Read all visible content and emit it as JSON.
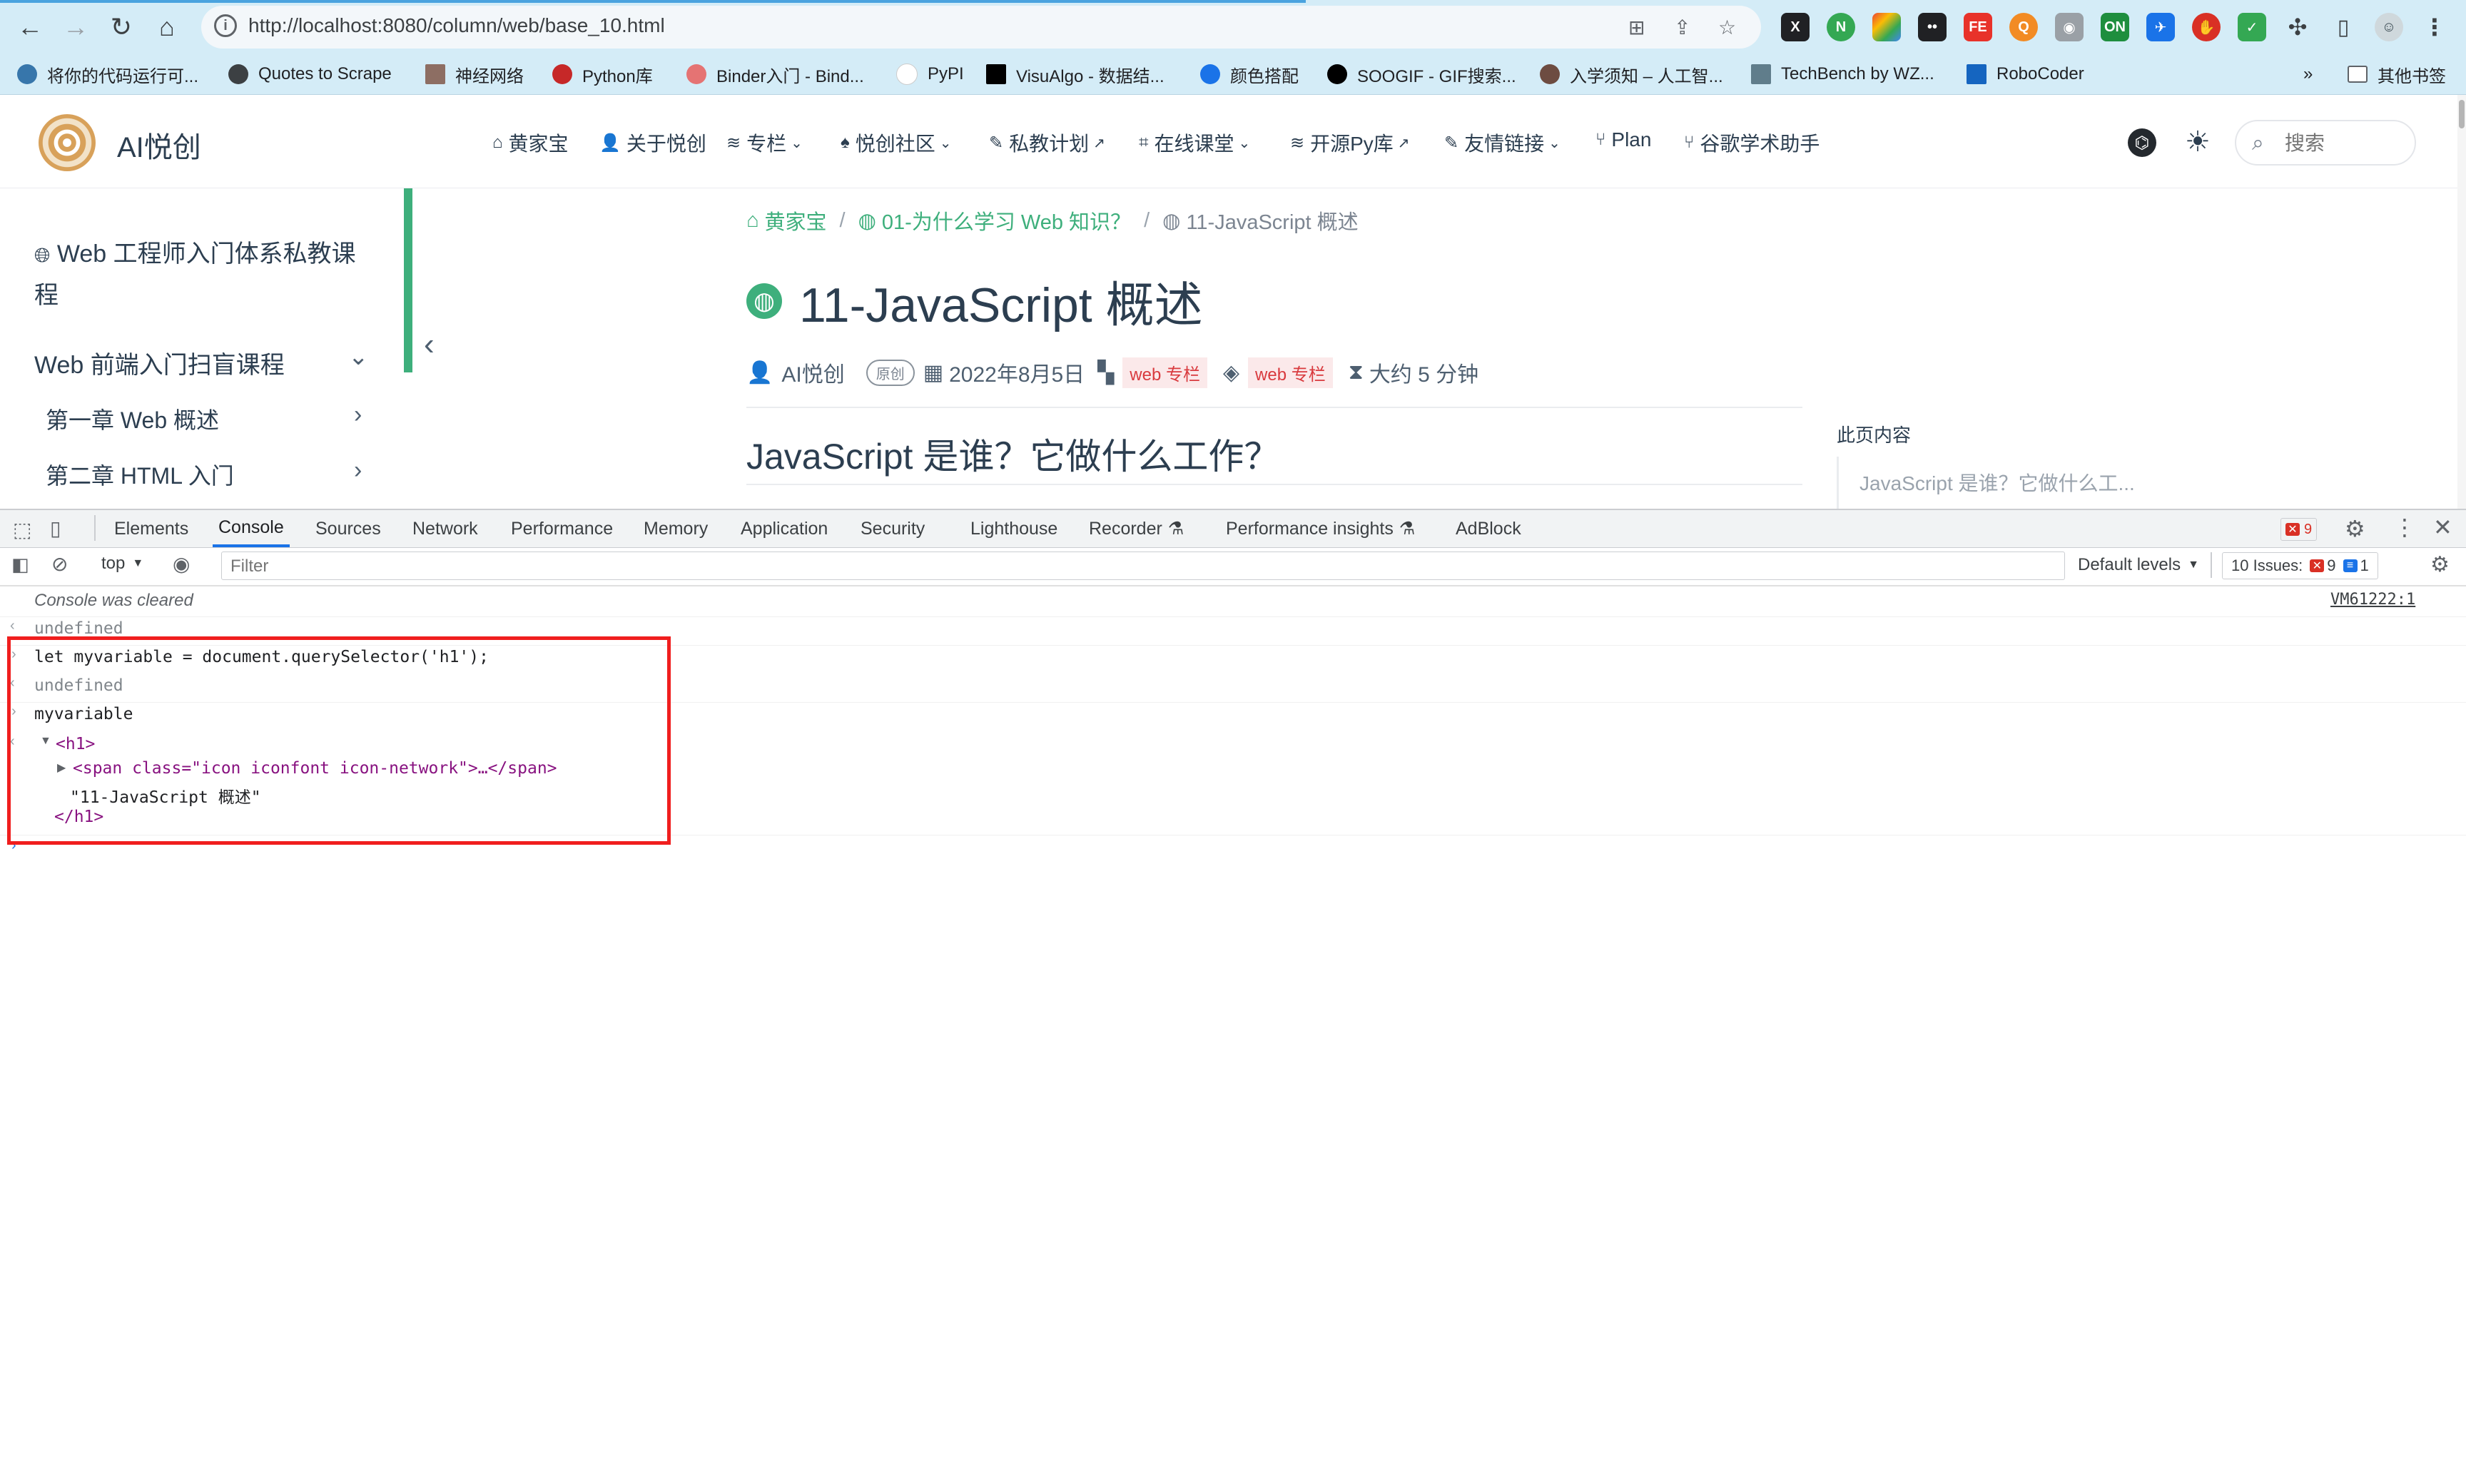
{
  "browser": {
    "url": "http://localhost:8080/column/web/base_10.html",
    "bookmarks": [
      "将你的代码运行可...",
      "Quotes to Scrape",
      "神经网络",
      "Python库",
      "Binder入门 - Bind...",
      "PyPI",
      "VisuAlgo - 数据结...",
      "颜色搭配",
      "SOOGIF - GIF搜索...",
      "入学须知 – 人工智...",
      "TechBench by WZ...",
      "RoboCoder"
    ],
    "bookmarks_more": "»",
    "other_bookmarks": "其他书签"
  },
  "site": {
    "title": "AI悦创",
    "nav": [
      "黄家宝",
      "关于悦创",
      "专栏",
      "悦创社区",
      "私教计划",
      "在线课堂",
      "开源Py库",
      "友情链接",
      "Plan",
      "谷歌学术助手"
    ],
    "search_placeholder": "搜索"
  },
  "sidebar": {
    "course": "Web 工程师入门体系私教课",
    "course_line2": "程",
    "section": "Web 前端入门扫盲课程",
    "chapters": [
      "第一章 Web 概述",
      "第二章 HTML 入门"
    ]
  },
  "article": {
    "breadcrumb": [
      "黄家宝",
      "01-为什么学习 Web 知识？",
      "11-JavaScript 概述"
    ],
    "breadcrumb_sep": "/",
    "title": "11-JavaScript 概述",
    "author": "AI悦创",
    "original": "原创",
    "date": "2022年8月5日",
    "category": "web 专栏",
    "tag": "web 专栏",
    "read_time": "大约 5 分钟",
    "section_heading": "JavaScript 是谁？它做什么工作？",
    "toc_title": "此页内容",
    "toc_item": "JavaScript 是谁？它做什么工..."
  },
  "devtools": {
    "tabs": [
      "Elements",
      "Console",
      "Sources",
      "Network",
      "Performance",
      "Memory",
      "Application",
      "Security",
      "Lighthouse",
      "Recorder",
      "Performance insights",
      "AdBlock"
    ],
    "active_tab": "Console",
    "error_count": "9",
    "context": "top",
    "filter_placeholder": "Filter",
    "levels": "Default levels",
    "issues_label": "10 Issues:",
    "issues_errors": "9",
    "issues_info": "1",
    "console": {
      "cleared": "Console was cleared",
      "cleared_source": "VM61222:1",
      "undefined1": "undefined",
      "input1": "let myvariable = document.querySelector('h1');",
      "undefined2": "undefined",
      "input2": "myvariable",
      "h1_open": "<h1>",
      "span_line": "<span class=\"icon iconfont icon-network\">…</span>",
      "text_node": "\"11-JavaScript 概述\"",
      "h1_close": "</h1>"
    }
  }
}
